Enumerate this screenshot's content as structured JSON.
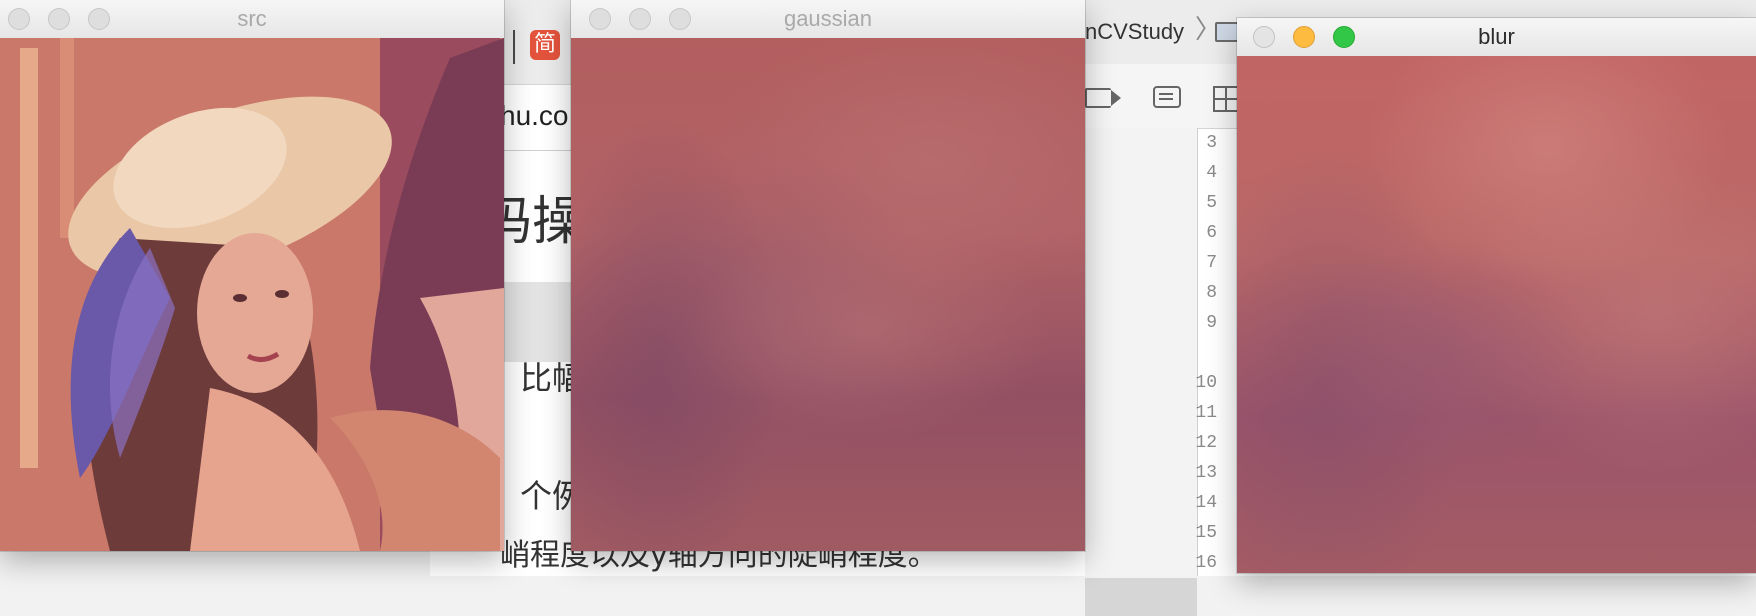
{
  "background": {
    "browser": {
      "jian_badge": "简",
      "url_fragment": "hu.co",
      "heading_fragment": "码操",
      "text_line1": "比幅度",
      "text_line2": "个例",
      "text_line3": "峭程度以及y轴方向的陡峭程度。"
    },
    "xcode": {
      "breadcrumb": "nCVStudy",
      "line_numbers": [
        "3",
        "4",
        "5",
        "6",
        "7",
        "8",
        "9",
        "10",
        "11",
        "12",
        "13",
        "14",
        "15",
        "16"
      ]
    }
  },
  "windows": [
    {
      "id": "src",
      "title": "src",
      "active": false
    },
    {
      "id": "gaussian",
      "title": "gaussian",
      "active": false
    },
    {
      "id": "blur",
      "title": "blur",
      "active": true
    }
  ],
  "icons": {
    "lena_image": "lena-photo",
    "gaussian_image": "gaussian-blurred-photo",
    "blur_image": "box-blurred-photo"
  }
}
